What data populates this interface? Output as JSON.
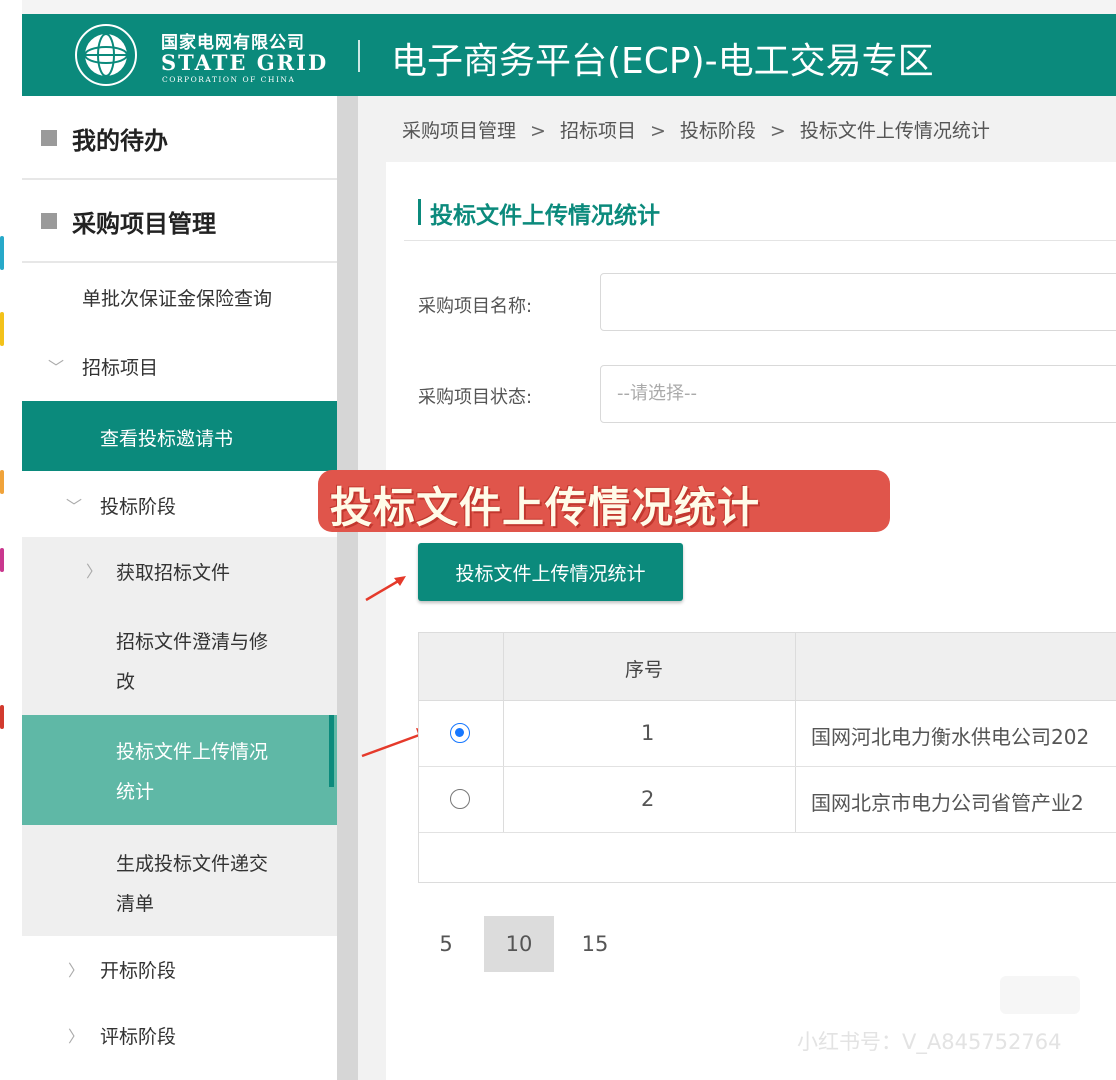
{
  "header": {
    "logo_cn": "国家电网有限公司",
    "logo_en": "STATE GRID",
    "logo_sub": "CORPORATION OF CHINA",
    "title": "电子商务平台(ECP)-电工交易专区",
    "color": "#0b8a7c"
  },
  "sidebar": {
    "group_todo": "我的待办",
    "group_procure": "采购项目管理",
    "item_bond_query": "单批次保证金保险查询",
    "item_bidding_project": "招标项目",
    "item_view_invitation": "查看投标邀请书",
    "item_bidding_stage": "投标阶段",
    "item_get_docs": "获取招标文件",
    "item_clarify_line1": "招标文件澄清与修",
    "item_clarify_line2": "改",
    "item_upload_stats_line1": "投标文件上传情况",
    "item_upload_stats_line2": "统计",
    "item_delivery_line1": "生成投标文件递交",
    "item_delivery_line2": "清单",
    "item_opening_stage": "开标阶段",
    "item_evaluation_stage": "评标阶段"
  },
  "breadcrumb": [
    "采购项目管理",
    ">",
    "招标项目",
    ">",
    "投标阶段",
    ">",
    "投标文件上传情况统计"
  ],
  "panel": {
    "title": "投标文件上传情况统计"
  },
  "form": {
    "project_name_label": "采购项目名称:",
    "project_name_value": "",
    "project_status_label": "采购项目状态:",
    "project_status_placeholder": "--请选择--"
  },
  "overlay_banner": "投标文件上传情况统计",
  "action_button": "投标文件上传情况统计",
  "table": {
    "header_seq": "序号",
    "rows": [
      {
        "selected": true,
        "seq": "1",
        "name": "国网河北电力衡水供电公司202"
      },
      {
        "selected": false,
        "seq": "2",
        "name": "国网北京市电力公司省管产业2"
      }
    ]
  },
  "pagination": {
    "sizes": [
      "5",
      "10",
      "15"
    ],
    "selected": "10"
  },
  "watermark": "小红书号：V_A845752764"
}
